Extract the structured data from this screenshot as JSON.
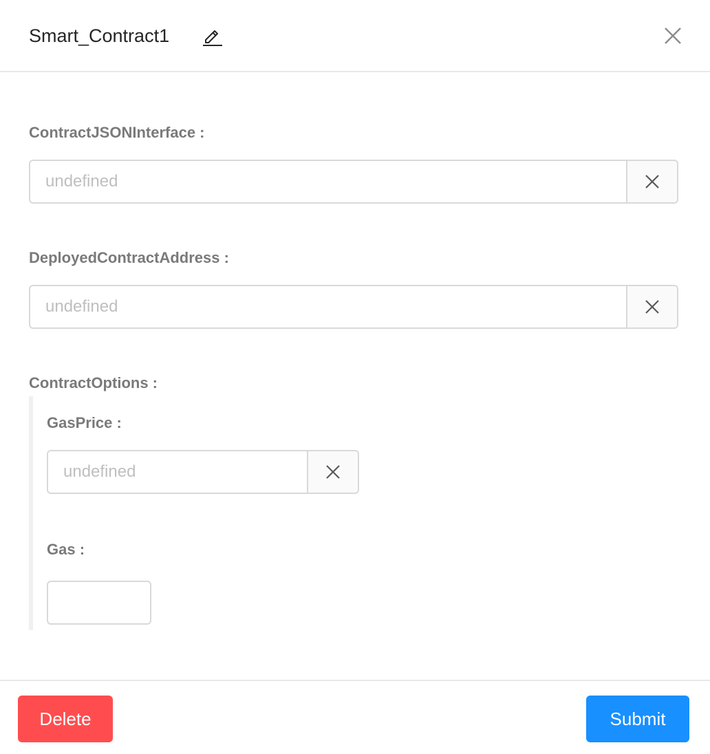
{
  "modal": {
    "title": "Smart_Contract1"
  },
  "icons": {
    "edit": "edit-icon",
    "close": "close-icon",
    "clear": "close-icon"
  },
  "fields": {
    "contract_json_interface": {
      "label": "ContractJSONInterface :",
      "placeholder": "undefined",
      "value": ""
    },
    "deployed_contract_address": {
      "label": "DeployedContractAddress :",
      "placeholder": "undefined",
      "value": ""
    },
    "contract_options": {
      "label": "ContractOptions :",
      "gas_price": {
        "label": "GasPrice :",
        "placeholder": "undefined",
        "value": ""
      },
      "gas": {
        "label": "Gas :",
        "value": ""
      }
    }
  },
  "footer": {
    "delete_label": "Delete",
    "submit_label": "Submit"
  },
  "colors": {
    "danger": "#ff4d4f",
    "primary": "#1890ff",
    "label": "#7a7a7a",
    "placeholder": "#bfbfbf",
    "border": "#d9d9d9"
  }
}
